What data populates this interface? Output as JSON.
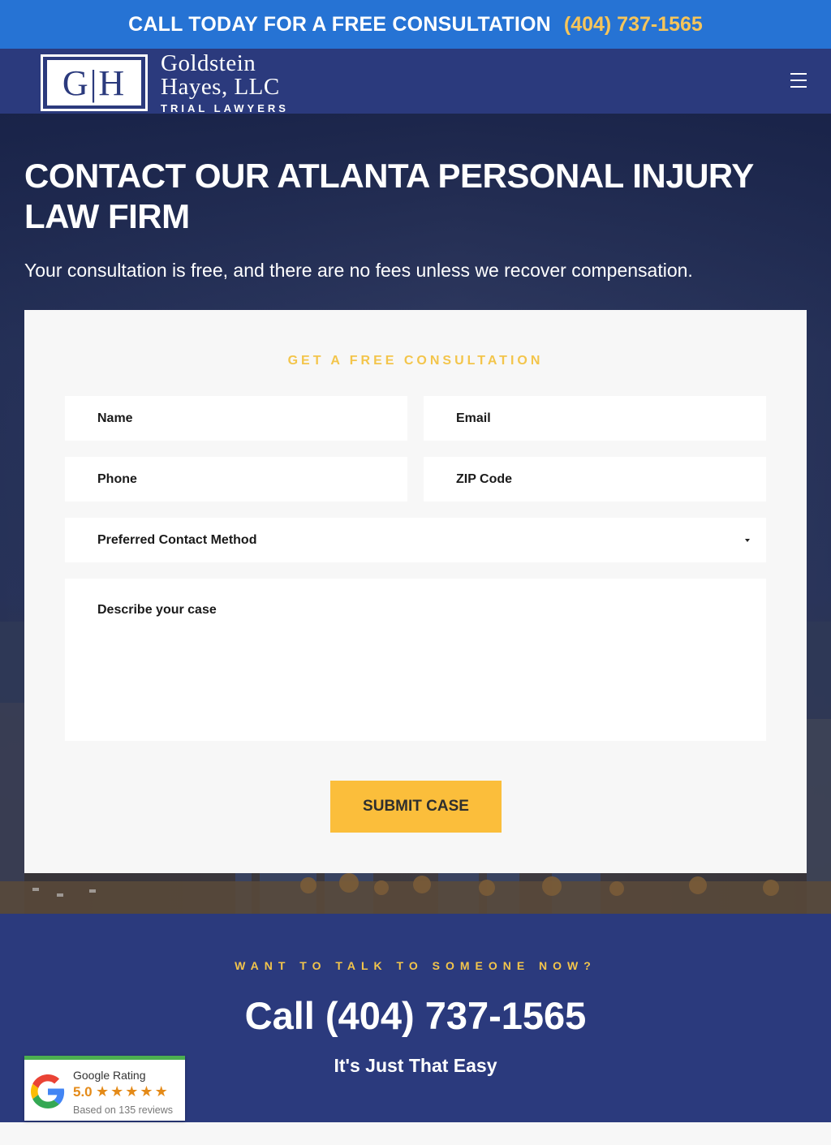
{
  "topbar": {
    "cta_text": "CALL TODAY FOR A FREE CONSULTATION",
    "phone": "(404) 737-1565"
  },
  "header": {
    "logo_monogram": "G|H",
    "logo_line1": "Goldstein",
    "logo_line2": "Hayes, LLC",
    "logo_line3": "TRIAL LAWYERS",
    "menu_icon": "hamburger-icon"
  },
  "hero": {
    "title": "CONTACT OUR ATLANTA PERSONAL INJURY LAW FIRM",
    "subhead": "Your consultation is free, and there are no fees unless we recover compensation."
  },
  "form": {
    "title": "GET A FREE CONSULTATION",
    "name_placeholder": "Name",
    "email_placeholder": "Email",
    "phone_placeholder": "Phone",
    "zip_placeholder": "ZIP Code",
    "method_placeholder": "Preferred Contact Method",
    "case_placeholder": "Describe your case",
    "submit_label": "SUBMIT CASE"
  },
  "cta": {
    "kicker": "WANT TO TALK TO SOMEONE NOW?",
    "call": "Call (404) 737-1565",
    "tagline": "It's Just That Easy"
  },
  "google_badge": {
    "label": "Google Rating",
    "score": "5.0",
    "stars": 5,
    "reviews": "Based on 135 reviews"
  },
  "colors": {
    "topbar": "#2673d4",
    "navy": "#2b3a7d",
    "gold": "#f3c54b",
    "button": "#fbbe3b",
    "star": "#e48a18"
  }
}
